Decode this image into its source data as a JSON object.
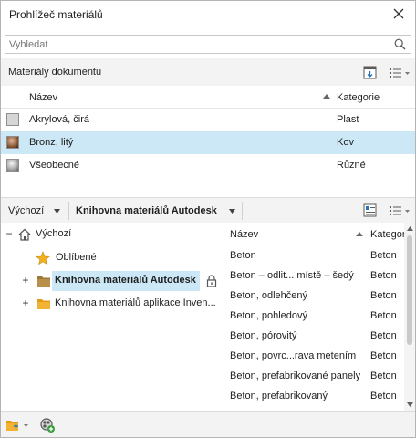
{
  "window": {
    "title": "Prohlížeč materiálů"
  },
  "search": {
    "placeholder": "Vyhledat"
  },
  "document": {
    "title": "Materiály dokumentu",
    "columns": {
      "name": "Název",
      "category": "Kategorie"
    },
    "materials": [
      {
        "name": "Akrylová, čirá",
        "category": "Plast",
        "selected": false
      },
      {
        "name": "Bronz, litý",
        "category": "Kov",
        "selected": true
      },
      {
        "name": "Všeobecné",
        "category": "Různé",
        "selected": false
      }
    ]
  },
  "library_toolbar": {
    "default_label": "Výchozí",
    "library_name": "Knihovna materiálů Autodesk"
  },
  "tree": {
    "nodes": [
      {
        "label": "Výchozí",
        "expander": "−"
      },
      {
        "label": "Oblíbené",
        "expander": ""
      },
      {
        "label": "Knihovna materiálů Autodesk",
        "expander": "+"
      },
      {
        "label": "Knihovna materiálů aplikace Inven...",
        "expander": "+"
      }
    ]
  },
  "library_list": {
    "columns": {
      "name": "Název",
      "category": "Kategor"
    },
    "items": [
      {
        "name": "Beton",
        "category": "Beton"
      },
      {
        "name": "Beton – odlit... místě – šedý",
        "category": "Beton"
      },
      {
        "name": "Beton, odlehčený",
        "category": "Beton"
      },
      {
        "name": "Beton, pohledový",
        "category": "Beton"
      },
      {
        "name": "Beton, pórovitý",
        "category": "Beton"
      },
      {
        "name": "Beton, povrc...rava metením",
        "category": "Beton"
      },
      {
        "name": "Beton, prefabrikované panely",
        "category": "Beton"
      },
      {
        "name": "Beton, prefabrikovaný",
        "category": "Beton"
      }
    ]
  },
  "colors": {
    "selection": "#cce8f6",
    "toolbar_bg": "#f3f3f3",
    "folder": "#e8a420",
    "star": "#f2b01e"
  },
  "icons": {
    "close": "close-icon",
    "search": "search-icon",
    "view_options": "view-options-icon",
    "create_material": "create-material-icon",
    "home": "home-icon",
    "star": "star-icon",
    "folder": "folder-icon",
    "lock": "lock-icon",
    "open_library": "open-library-icon",
    "material_editor": "material-editor-icon"
  }
}
